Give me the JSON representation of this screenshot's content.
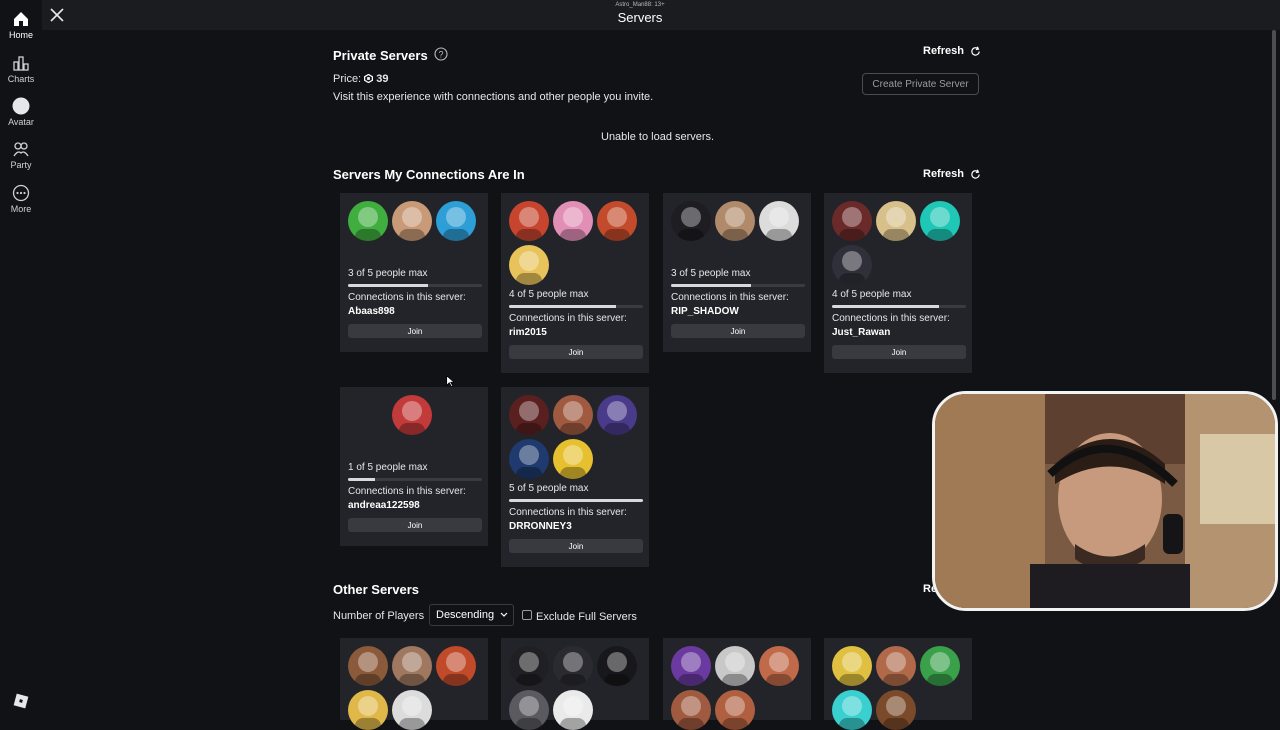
{
  "topbar": {
    "user_line": "Astro_Man88: 13+",
    "title": "Servers"
  },
  "sidebar": {
    "items": [
      {
        "label": "Home",
        "icon": "home-icon"
      },
      {
        "label": "Charts",
        "icon": "charts-icon"
      },
      {
        "label": "Avatar",
        "icon": "avatar-icon"
      },
      {
        "label": "Party",
        "icon": "party-icon"
      },
      {
        "label": "More",
        "icon": "more-icon"
      }
    ],
    "bottom_icon": "roblox-logo-icon"
  },
  "private": {
    "title": "Private Servers",
    "price_label": "Price:",
    "price_value": "39",
    "description": "Visit this experience with connections and other people you invite.",
    "refresh_label": "Refresh",
    "create_label": "Create Private Server",
    "error": "Unable to load servers."
  },
  "connections": {
    "title": "Servers My Connections Are In",
    "refresh_label": "Refresh",
    "conn_label": "Connections in this server:",
    "join_label": "Join",
    "servers": [
      {
        "capacity": "3 of 5 people max",
        "fill_ratio": 0.6,
        "connection": "Abaas898",
        "avatar_colors": [
          "#3fae3f",
          "#c99a78",
          "#2d9ed6"
        ]
      },
      {
        "capacity": "4 of 5 people max",
        "fill_ratio": 0.8,
        "connection": "rim2015",
        "avatar_colors": [
          "#c7452e",
          "#e28fb6",
          "#c34a2a",
          "#e8c25a"
        ]
      },
      {
        "capacity": "3 of 5 people max",
        "fill_ratio": 0.6,
        "connection": "RIP_SHADOW",
        "avatar_colors": [
          "#1d1d22",
          "#b08a6a",
          "#dcdcdc"
        ]
      },
      {
        "capacity": "4 of 5 people max",
        "fill_ratio": 0.8,
        "connection": "Just_Rawan",
        "avatar_colors": [
          "#6b2a2a",
          "#d8c08a",
          "#1fc7b6",
          "#30303a"
        ]
      },
      {
        "capacity": "1 of 5 people max",
        "fill_ratio": 0.2,
        "connection": "andreaa122598",
        "avatar_colors": [
          "#c33a3a"
        ]
      },
      {
        "capacity": "5 of 5 people max",
        "fill_ratio": 1.0,
        "connection": "DRRONNEY3",
        "avatar_colors": [
          "#5a2020",
          "#a05a40",
          "#4a3a8a",
          "#1e3a6e",
          "#e6c02e"
        ]
      }
    ]
  },
  "other": {
    "title": "Other Servers",
    "refresh_label": "Refresh",
    "players_label": "Number of Players",
    "sort_value": "Descending",
    "exclude_label": "Exclude Full Servers",
    "servers": [
      {
        "avatar_colors": [
          "#8a5a3a",
          "#a07860",
          "#c04a2a",
          "#e0b84a",
          "#dcdcdc"
        ]
      },
      {
        "avatar_colors": [
          "#202024",
          "#2a2a30",
          "#18181c",
          "#5a5a60",
          "#eaeaea"
        ]
      },
      {
        "avatar_colors": [
          "#6a3aa0",
          "#c8c8c8",
          "#c06a4a",
          "#a05a40",
          "#b06040"
        ]
      },
      {
        "avatar_colors": [
          "#e0c040",
          "#b06a4a",
          "#3aa04a",
          "#3ad0d0",
          "#7a4a2a"
        ]
      }
    ]
  }
}
